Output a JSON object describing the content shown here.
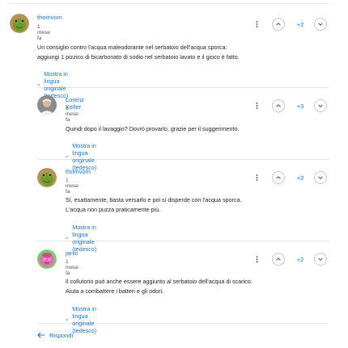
{
  "colors": {
    "accent": "#1a73c8",
    "divider": "#e6e6e6",
    "text": "#1f1f1f"
  },
  "comments": [
    {
      "author": "thomvom",
      "time": "1 mese fa",
      "score": "+2",
      "avatar_icon": "frog-avatar-icon",
      "lines": [
        "Un consiglio contro l'acqua maleodorante nel serbatoio dell'acqua sporca:",
        "aggiungi 1 pizzico di bicarbonato di sodio nel serbatoio lavato e il gioco è fatto."
      ],
      "translate_label": "Mostra in lingua originale (tedesco)"
    },
    {
      "author": "Lorenz Keller",
      "time": "1 mese fa",
      "score": "+3",
      "avatar_icon": "person-avatar-icon",
      "lines": [
        "Quindi dopo il lavaggio? Dovrò provarlo, grazie per il suggerimento."
      ],
      "translate_label": "Mostra in lingua originale (tedesco)"
    },
    {
      "author": "thomvom",
      "time": "1 mese fa",
      "score": "+2",
      "avatar_icon": "frog-avatar-icon",
      "lines": [
        "Sì, esattamente, basta versarlo e poi si disperde con l'acqua sporca.",
        "L'acqua non puzza praticamente più."
      ],
      "translate_label": "Mostra in lingua originale (tedesco)"
    },
    {
      "author": "janiii",
      "time": "1 mese fa",
      "score": "+2",
      "avatar_icon": "pink-creature-avatar-icon",
      "lines": [
        "Il collutorio può anche essere aggiunto al serbatoio dell'acqua di scarico.",
        "Aiuta a combattere i batteri e gli odori."
      ],
      "translate_label": "Mostra in lingua originale (tedesco)"
    }
  ],
  "reply_label": "Rispondi"
}
